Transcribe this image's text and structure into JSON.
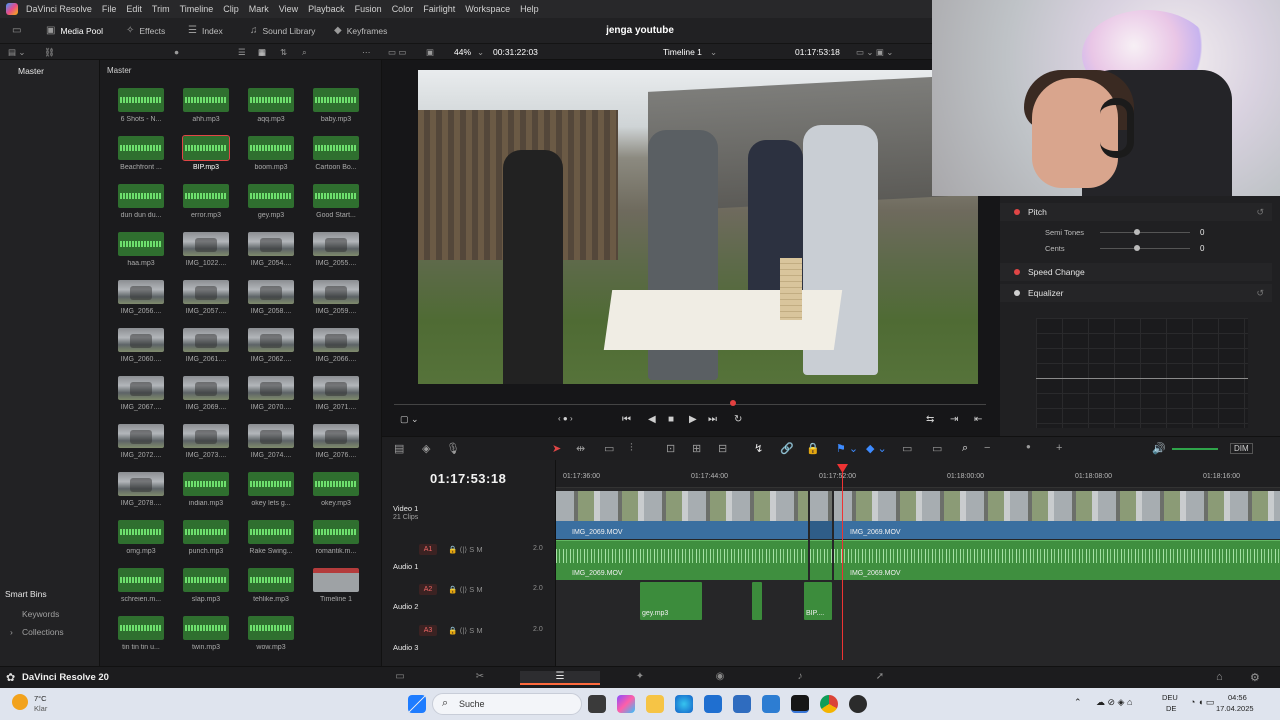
{
  "menu": {
    "items": [
      "DaVinci Resolve",
      "File",
      "Edit",
      "Trim",
      "Timeline",
      "Clip",
      "Mark",
      "View",
      "Playback",
      "Fusion",
      "Color",
      "Fairlight",
      "Workspace",
      "Help"
    ]
  },
  "toolbar": {
    "media_pool": "Media Pool",
    "effects": "Effects",
    "index": "Index",
    "sound_library": "Sound Library",
    "keyframes": "Keyframes",
    "project_title": "jenga youtube"
  },
  "viewer_bar": {
    "zoom": "44%",
    "source_timecode": "00:31:22:03",
    "timeline_name": "Timeline 1",
    "record_timecode": "01:17:53:18"
  },
  "bins": {
    "master": "Master",
    "smart_bins": "Smart Bins",
    "keywords": "Keywords",
    "collections": "Collections"
  },
  "media_pool": {
    "header": "Master",
    "clips": [
      {
        "name": "6 Shots - N...",
        "kind": "audio"
      },
      {
        "name": "ahh.mp3",
        "kind": "audio"
      },
      {
        "name": "aqq.mp3",
        "kind": "audio"
      },
      {
        "name": "baby.mp3",
        "kind": "audio"
      },
      {
        "name": "Beachfront ...",
        "kind": "audio"
      },
      {
        "name": "BIP.mp3",
        "kind": "audio",
        "selected": true
      },
      {
        "name": "boom.mp3",
        "kind": "audio"
      },
      {
        "name": "Cartoon Bo...",
        "kind": "audio"
      },
      {
        "name": "dun dun du...",
        "kind": "audio"
      },
      {
        "name": "error.mp3",
        "kind": "audio"
      },
      {
        "name": "gey.mp3",
        "kind": "audio"
      },
      {
        "name": "Good Start...",
        "kind": "audio"
      },
      {
        "name": "haa.mp3",
        "kind": "audio"
      },
      {
        "name": "IMG_1022....",
        "kind": "video"
      },
      {
        "name": "IMG_2054....",
        "kind": "video"
      },
      {
        "name": "IMG_2055....",
        "kind": "video"
      },
      {
        "name": "IMG_2056....",
        "kind": "video"
      },
      {
        "name": "IMG_2057....",
        "kind": "video"
      },
      {
        "name": "IMG_2058....",
        "kind": "video"
      },
      {
        "name": "IMG_2059....",
        "kind": "video"
      },
      {
        "name": "IMG_2060....",
        "kind": "video"
      },
      {
        "name": "IMG_2061....",
        "kind": "video"
      },
      {
        "name": "IMG_2062....",
        "kind": "video"
      },
      {
        "name": "IMG_2066....",
        "kind": "video"
      },
      {
        "name": "IMG_2067....",
        "kind": "video"
      },
      {
        "name": "IMG_2069....",
        "kind": "video"
      },
      {
        "name": "IMG_2070....",
        "kind": "video"
      },
      {
        "name": "IMG_2071....",
        "kind": "video"
      },
      {
        "name": "IMG_2072....",
        "kind": "video"
      },
      {
        "name": "IMG_2073....",
        "kind": "video"
      },
      {
        "name": "IMG_2074....",
        "kind": "video"
      },
      {
        "name": "IMG_2076....",
        "kind": "video"
      },
      {
        "name": "IMG_2078....",
        "kind": "video"
      },
      {
        "name": "indian.mp3",
        "kind": "audio"
      },
      {
        "name": "okey lets g...",
        "kind": "audio"
      },
      {
        "name": "okey.mp3",
        "kind": "audio"
      },
      {
        "name": "omg.mp3",
        "kind": "audio"
      },
      {
        "name": "punch.mp3",
        "kind": "audio"
      },
      {
        "name": "Rake Swing...",
        "kind": "audio"
      },
      {
        "name": "romantik.m...",
        "kind": "audio"
      },
      {
        "name": "schreien.m...",
        "kind": "audio"
      },
      {
        "name": "slap.mp3",
        "kind": "audio"
      },
      {
        "name": "tehlike.mp3",
        "kind": "audio"
      },
      {
        "name": "Timeline 1",
        "kind": "timeline"
      },
      {
        "name": "tin tin tin u...",
        "kind": "audio"
      },
      {
        "name": "twin.mp3",
        "kind": "audio"
      },
      {
        "name": "wow.mp3",
        "kind": "audio"
      }
    ]
  },
  "inspector": {
    "pitch": "Pitch",
    "semi_tones_label": "Semi Tones",
    "semi_tones_value": "0",
    "cents_label": "Cents",
    "cents_value": "0",
    "speed_change": "Speed Change",
    "equalizer": "Equalizer"
  },
  "timeline": {
    "timecode": "01:17:53:18",
    "ruler": [
      "01:17:36:00",
      "01:17:44:00",
      "01:17:52:00",
      "01:18:00:00",
      "01:18:08:00",
      "01:18:16:00"
    ],
    "tracks": {
      "video1": {
        "name": "Video 1",
        "sub": "21 Clips"
      },
      "audio1": {
        "badge": "A1",
        "name": "Audio 1",
        "level": "2.0"
      },
      "audio2": {
        "badge": "A2",
        "name": "Audio 2",
        "level": "2.0"
      },
      "audio3": {
        "badge": "A3",
        "name": "Audio 3",
        "level": "2.0"
      }
    },
    "clips": {
      "video_a": "IMG_2069.MOV",
      "video_b": "IMG_2069.MOV",
      "audio_a": "IMG_2069.MOV",
      "audio_b": "IMG_2069.MOV",
      "sfx_gey": "gey.mp3",
      "sfx_bip": "BIP...."
    },
    "dim": "DIM"
  },
  "app_bar": {
    "brand": "DaVinci Resolve 20"
  },
  "taskbar": {
    "search": "Suche",
    "weather_temp": "7°C",
    "weather_text": "Klar",
    "lang_top": "DEU",
    "lang_bottom": "DE",
    "time": "04:56",
    "date": "17.04.2025"
  }
}
